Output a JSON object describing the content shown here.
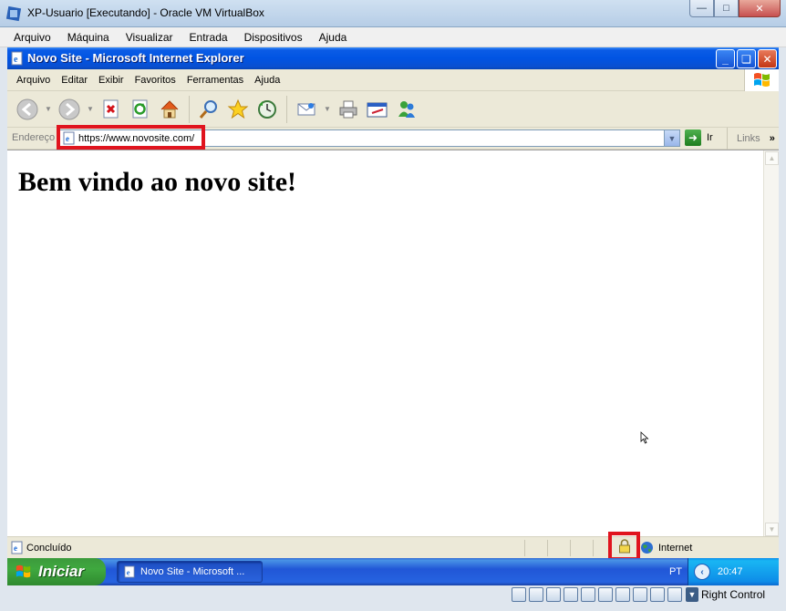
{
  "vbox": {
    "title": "XP-Usuario [Executando] - Oracle VM VirtualBox",
    "menu": [
      "Arquivo",
      "Máquina",
      "Visualizar",
      "Entrada",
      "Dispositivos",
      "Ajuda"
    ],
    "right_control": "Right Control"
  },
  "ie": {
    "title": "Novo Site - Microsoft Internet Explorer",
    "menu": [
      "Arquivo",
      "Editar",
      "Exibir",
      "Favoritos",
      "Ferramentas",
      "Ajuda"
    ],
    "address_label": "Endereço",
    "url": "https://www.novosite.com/",
    "go_label": "Ir",
    "links_label": "Links",
    "toolbar_icons": [
      "back-icon",
      "forward-icon",
      "stop-icon",
      "refresh-icon",
      "home-icon",
      "search-icon",
      "favorites-icon",
      "history-icon",
      "mail-icon",
      "print-icon",
      "edit-icon",
      "messenger-icon"
    ],
    "status_text": "Concluído",
    "zone_label": "Internet"
  },
  "page": {
    "heading": "Bem vindo ao novo site!"
  },
  "taskbar": {
    "start_label": "Iniciar",
    "task_label": "Novo Site - Microsoft ...",
    "language": "PT",
    "clock": "20:47"
  },
  "colors": {
    "highlight": "#e0141e",
    "xp_title_blue": "#0054e3",
    "start_green": "#3fa83f"
  }
}
